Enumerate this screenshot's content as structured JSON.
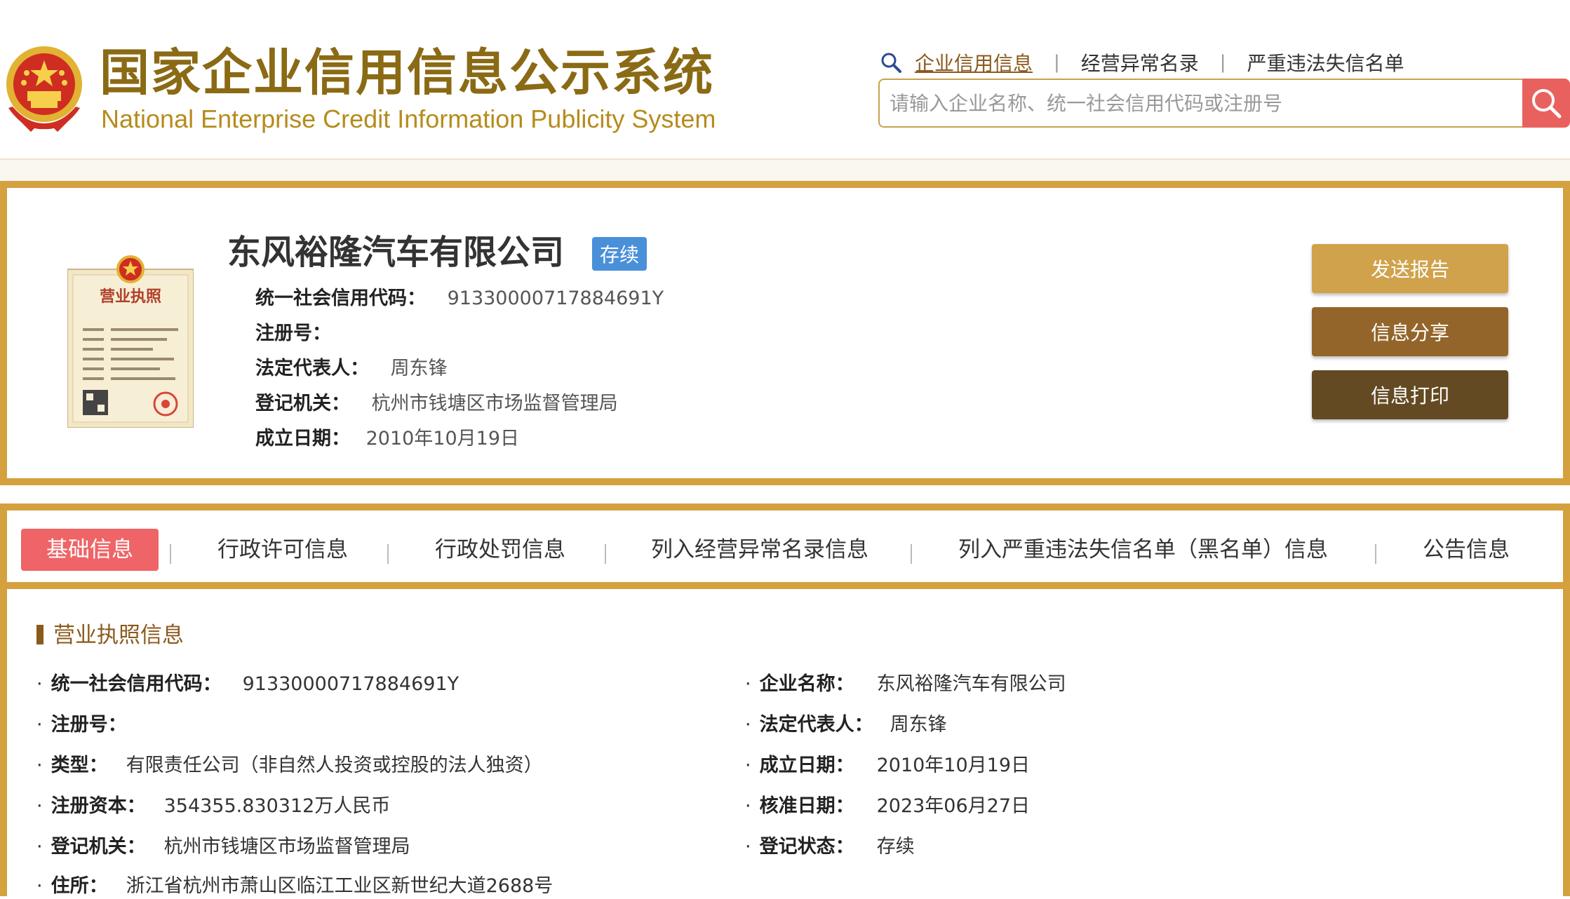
{
  "header": {
    "title_cn": "国家企业信用信息公示系统",
    "title_en": "National Enterprise Credit Information Publicity System",
    "nav": [
      "企业信用信息",
      "经营异常名录",
      "严重违法失信名单"
    ],
    "search_placeholder": "请输入企业名称、统一社会信用代码或注册号"
  },
  "company": {
    "name": "东风裕隆汽车有限公司",
    "status": "存续",
    "license_title": "营业执照",
    "fields": [
      {
        "label": "统一社会信用代码：",
        "value": "91330000717884691Y"
      },
      {
        "label": "注册号：",
        "value": ""
      },
      {
        "label": "法定代表人：",
        "value": "周东锋"
      },
      {
        "label": "登记机关：",
        "value": "杭州市钱塘区市场监督管理局"
      },
      {
        "label": "成立日期：",
        "value": "2010年10月19日"
      }
    ],
    "buttons": {
      "send": "发送报告",
      "share": "信息分享",
      "print": "信息打印"
    }
  },
  "tabs": [
    "基础信息",
    "行政许可信息",
    "行政处罚信息",
    "列入经营异常名录信息",
    "列入严重违法失信名单（黑名单）信息",
    "公告信息"
  ],
  "detail": {
    "section_title": "营业执照信息",
    "left": [
      {
        "label": "统一社会信用代码：",
        "value": "91330000717884691Y"
      },
      {
        "label": "注册号：",
        "value": ""
      },
      {
        "label": "类型：",
        "value": "有限责任公司（非自然人投资或控股的法人独资）"
      },
      {
        "label": "注册资本：",
        "value": "354355.830312万人民币"
      },
      {
        "label": "登记机关：",
        "value": "杭州市钱塘区市场监督管理局"
      },
      {
        "label": "住所：",
        "value": "浙江省杭州市萧山区临江工业区新世纪大道2688号"
      }
    ],
    "right": [
      {
        "label": "企业名称：",
        "value": "东风裕隆汽车有限公司"
      },
      {
        "label": "法定代表人：",
        "value": "周东锋"
      },
      {
        "label": "成立日期：",
        "value": "2010年10月19日"
      },
      {
        "label": "核准日期：",
        "value": "2023年06月27日"
      },
      {
        "label": "登记状态：",
        "value": "存续"
      }
    ]
  },
  "colors": {
    "gold_border": "#d4a13e",
    "active_tab": "#ef6466",
    "badge": "#4a90d9"
  }
}
